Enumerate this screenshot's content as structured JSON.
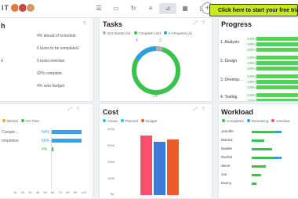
{
  "topbar": {
    "logo": "IT",
    "icons": [
      "list-icon",
      "tasks-icon",
      "sync-icon",
      "timeline-icon",
      "dashboard-icon",
      "calendar-icon",
      "document-icon"
    ],
    "trial_label": "Click here to start your free trial"
  },
  "health": {
    "title": "h",
    "rows": [
      {
        "label": "",
        "value": "4% ahead of schedule."
      },
      {
        "label": "",
        "value": "6 tasks to be completed."
      },
      {
        "label": "d",
        "value": "0 tasks overdue."
      },
      {
        "label": "",
        "value": "92% complete."
      },
      {
        "label": "",
        "value": "4% over budget."
      }
    ]
  },
  "tasks": {
    "title": "Tasks",
    "legend": [
      "Not Started (0)",
      "Complete (24)",
      "In Progress (4)"
    ],
    "labels": {
      "left": "4",
      "top": "2",
      "bottom": "24"
    }
  },
  "progress": {
    "title": "Progress",
    "items": [
      {
        "label": "1. Analysis",
        "pcts": [
          "100%",
          "100%",
          "100%"
        ]
      },
      {
        "label": "2. Design",
        "pcts": [
          "100%",
          "100%",
          "100%"
        ]
      },
      {
        "label": "3. Develop...",
        "pcts": [
          "100%",
          "100%",
          "100%"
        ]
      },
      {
        "label": "4. Testing",
        "pcts": [
          "100%",
          "100%"
        ]
      }
    ]
  },
  "time": {
    "title": "",
    "legend": [
      "Behind",
      "On Time"
    ],
    "rows": [
      {
        "label": "Comple...",
        "pct": "64%"
      },
      {
        "label": "ompletion",
        "pct": "66%"
      },
      {
        "label": "",
        "pct": "4%"
      }
    ],
    "ticks": [
      "10",
      "20",
      "30",
      "40",
      "50",
      "60",
      "70",
      "80",
      "90",
      "100"
    ]
  },
  "cost": {
    "title": "Cost",
    "legend": [
      "Actual",
      "Planned",
      "Budget"
    ],
    "yticks": [
      "400K",
      "300K",
      "200K",
      "100K",
      "$0"
    ],
    "colors": {
      "actual": "#ff4d6d",
      "planned": "#3f7bd6",
      "budget": "#f05a28"
    }
  },
  "workload": {
    "title": "Workload",
    "legend": [
      "Completed",
      "Remaining",
      "Overdue"
    ],
    "names": [
      "Jennifer",
      "Monica",
      "Natalie",
      "Rachel",
      "Steve",
      "Joe",
      "Danny"
    ]
  }
}
